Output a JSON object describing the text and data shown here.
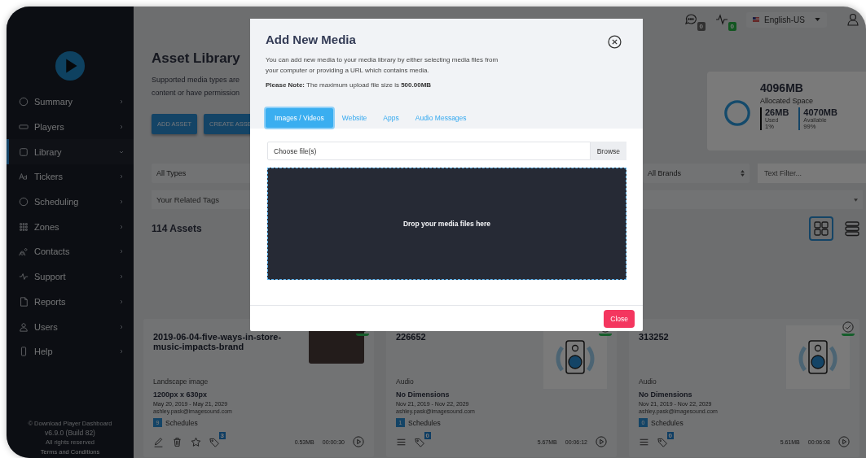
{
  "sidebar": {
    "items": [
      {
        "label": "Summary",
        "selected": false,
        "expanded": false
      },
      {
        "label": "Players",
        "selected": false,
        "expanded": false
      },
      {
        "label": "Library",
        "selected": true,
        "expanded": true
      },
      {
        "label": "Tickers",
        "selected": false,
        "expanded": false
      },
      {
        "label": "Scheduling",
        "selected": false,
        "expanded": false
      },
      {
        "label": "Zones",
        "selected": false,
        "expanded": false
      },
      {
        "label": "Contacts",
        "selected": false,
        "expanded": false
      },
      {
        "label": "Support",
        "selected": false,
        "expanded": false
      },
      {
        "label": "Reports",
        "selected": false,
        "expanded": false
      },
      {
        "label": "Users",
        "selected": false,
        "expanded": false
      },
      {
        "label": "Help",
        "selected": false,
        "expanded": false
      }
    ],
    "footer": [
      "© Download Player Dashboard",
      "v6.9.0 (Build 82)",
      "All rights reserved",
      "Terms and Conditions"
    ]
  },
  "topbar": {
    "messages_badge": "0",
    "alerts_badge": "0",
    "language": "English-US"
  },
  "header": {
    "title": "Asset Library",
    "description": [
      "Supported media types are",
      "content or have permission"
    ],
    "buttons": [
      "ADD ASSET",
      "CREATE ASSE"
    ]
  },
  "storage": {
    "total": "4096MB",
    "label": "Allocated Space",
    "used": {
      "value": "26MB",
      "label": "Used",
      "percent": "1%"
    },
    "available": {
      "value": "4070MB",
      "label": "Available",
      "percent": "99%"
    }
  },
  "filters": {
    "type": "All Types",
    "brand": "All Brands",
    "text_placeholder": "Text Filter...",
    "tags_placeholder": "Your Related Tags"
  },
  "asset_count": "114 Assets",
  "view_toggles": [
    {
      "kind": "grid",
      "selected": true
    },
    {
      "kind": "list",
      "selected": false
    }
  ],
  "assets": [
    {
      "kind": "image",
      "title": "2019-06-04-five-ways-in-store-music-impacts-brand",
      "type": "Landscape image",
      "dimensions": "1200px x 630px",
      "dates": "May 20, 2019 - May 21, 2029",
      "owner": "ashley.pask@imagesound.com",
      "schedules": "9",
      "schedules_label": "Schedules",
      "tags": "3",
      "size": "0.53MB",
      "duration": "00:00:30"
    },
    {
      "kind": "audio",
      "title": "226652",
      "type": "Audio",
      "dimensions": "No Dimensions",
      "dates": "Nov 21, 2019 - Nov 22, 2029",
      "owner": "ashley.pask@imagesound.com",
      "schedules": "1",
      "schedules_label": "Schedules",
      "tags": "0",
      "size": "5.67MB",
      "duration": "00:06:12"
    },
    {
      "kind": "audio",
      "title": "313252",
      "type": "Audio",
      "dimensions": "No Dimensions",
      "dates": "Nov 21, 2019 - Nov 22, 2029",
      "owner": "ashley.pask@imagesound.com",
      "schedules": "0",
      "schedules_label": "Schedules",
      "tags": "0",
      "size": "5.61MB",
      "duration": "00:06:08"
    }
  ],
  "modal": {
    "title": "Add New Media",
    "description": "You can add new media to your media library by either selecting media files from your computer or providing a URL which contains media.",
    "note": "**Please Note:** The maximum upload file size is **500.00MB**",
    "tabs": [
      {
        "label": "Images / Videos",
        "selected": true
      },
      {
        "label": "Website",
        "selected": false
      },
      {
        "label": "Apps",
        "selected": false
      },
      {
        "label": "Audio Messages",
        "selected": false
      }
    ],
    "file_placeholder": "Choose file(s)",
    "browse": "Browse",
    "dropzone": "Drop your media files here",
    "close": "Close"
  }
}
